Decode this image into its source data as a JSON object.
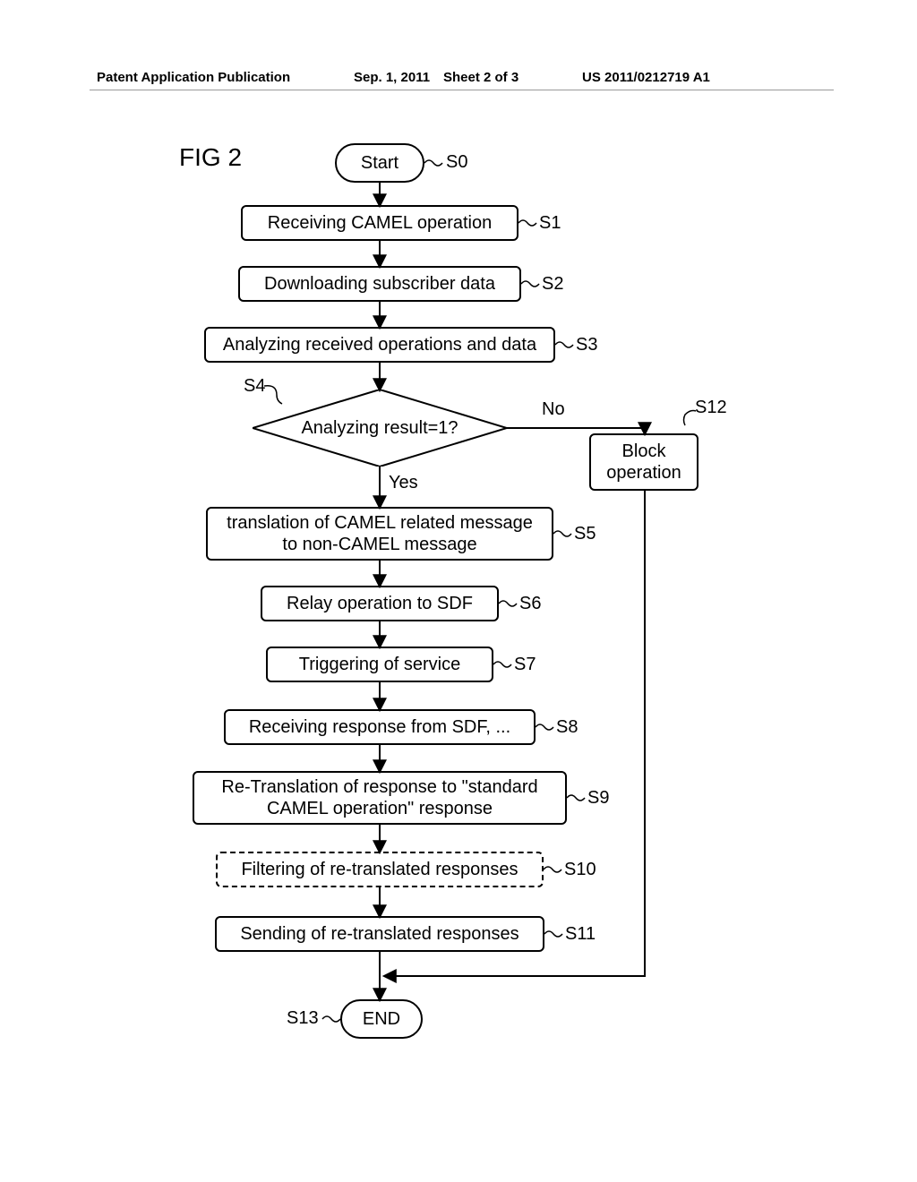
{
  "header": {
    "pub": "Patent Application Publication",
    "date": "Sep. 1, 2011",
    "sheet": "Sheet 2 of 3",
    "pubno": "US 2011/0212719 A1"
  },
  "figure": {
    "title": "FIG 2",
    "start": "Start",
    "end": "END",
    "s1": "Receiving CAMEL operation",
    "s2": "Downloading subscriber data",
    "s3": "Analyzing received operations and data",
    "s4": "Analyzing result=1?",
    "s5": "translation of CAMEL related message\nto non-CAMEL message",
    "s6": "Relay operation to SDF",
    "s7": "Triggering of service",
    "s8": "Receiving response from SDF, ...",
    "s9": "Re-Translation of response to \"standard\nCAMEL operation\" response",
    "s10": "Filtering of re-translated responses",
    "s11": "Sending of re-translated responses",
    "s12": "Block\noperation",
    "labels": {
      "S0": "S0",
      "S1": "S1",
      "S2": "S2",
      "S3": "S3",
      "S4": "S4",
      "S5": "S5",
      "S6": "S6",
      "S7": "S7",
      "S8": "S8",
      "S9": "S9",
      "S10": "S10",
      "S11": "S11",
      "S12": "S12",
      "S13": "S13",
      "yes": "Yes",
      "no": "No"
    }
  }
}
